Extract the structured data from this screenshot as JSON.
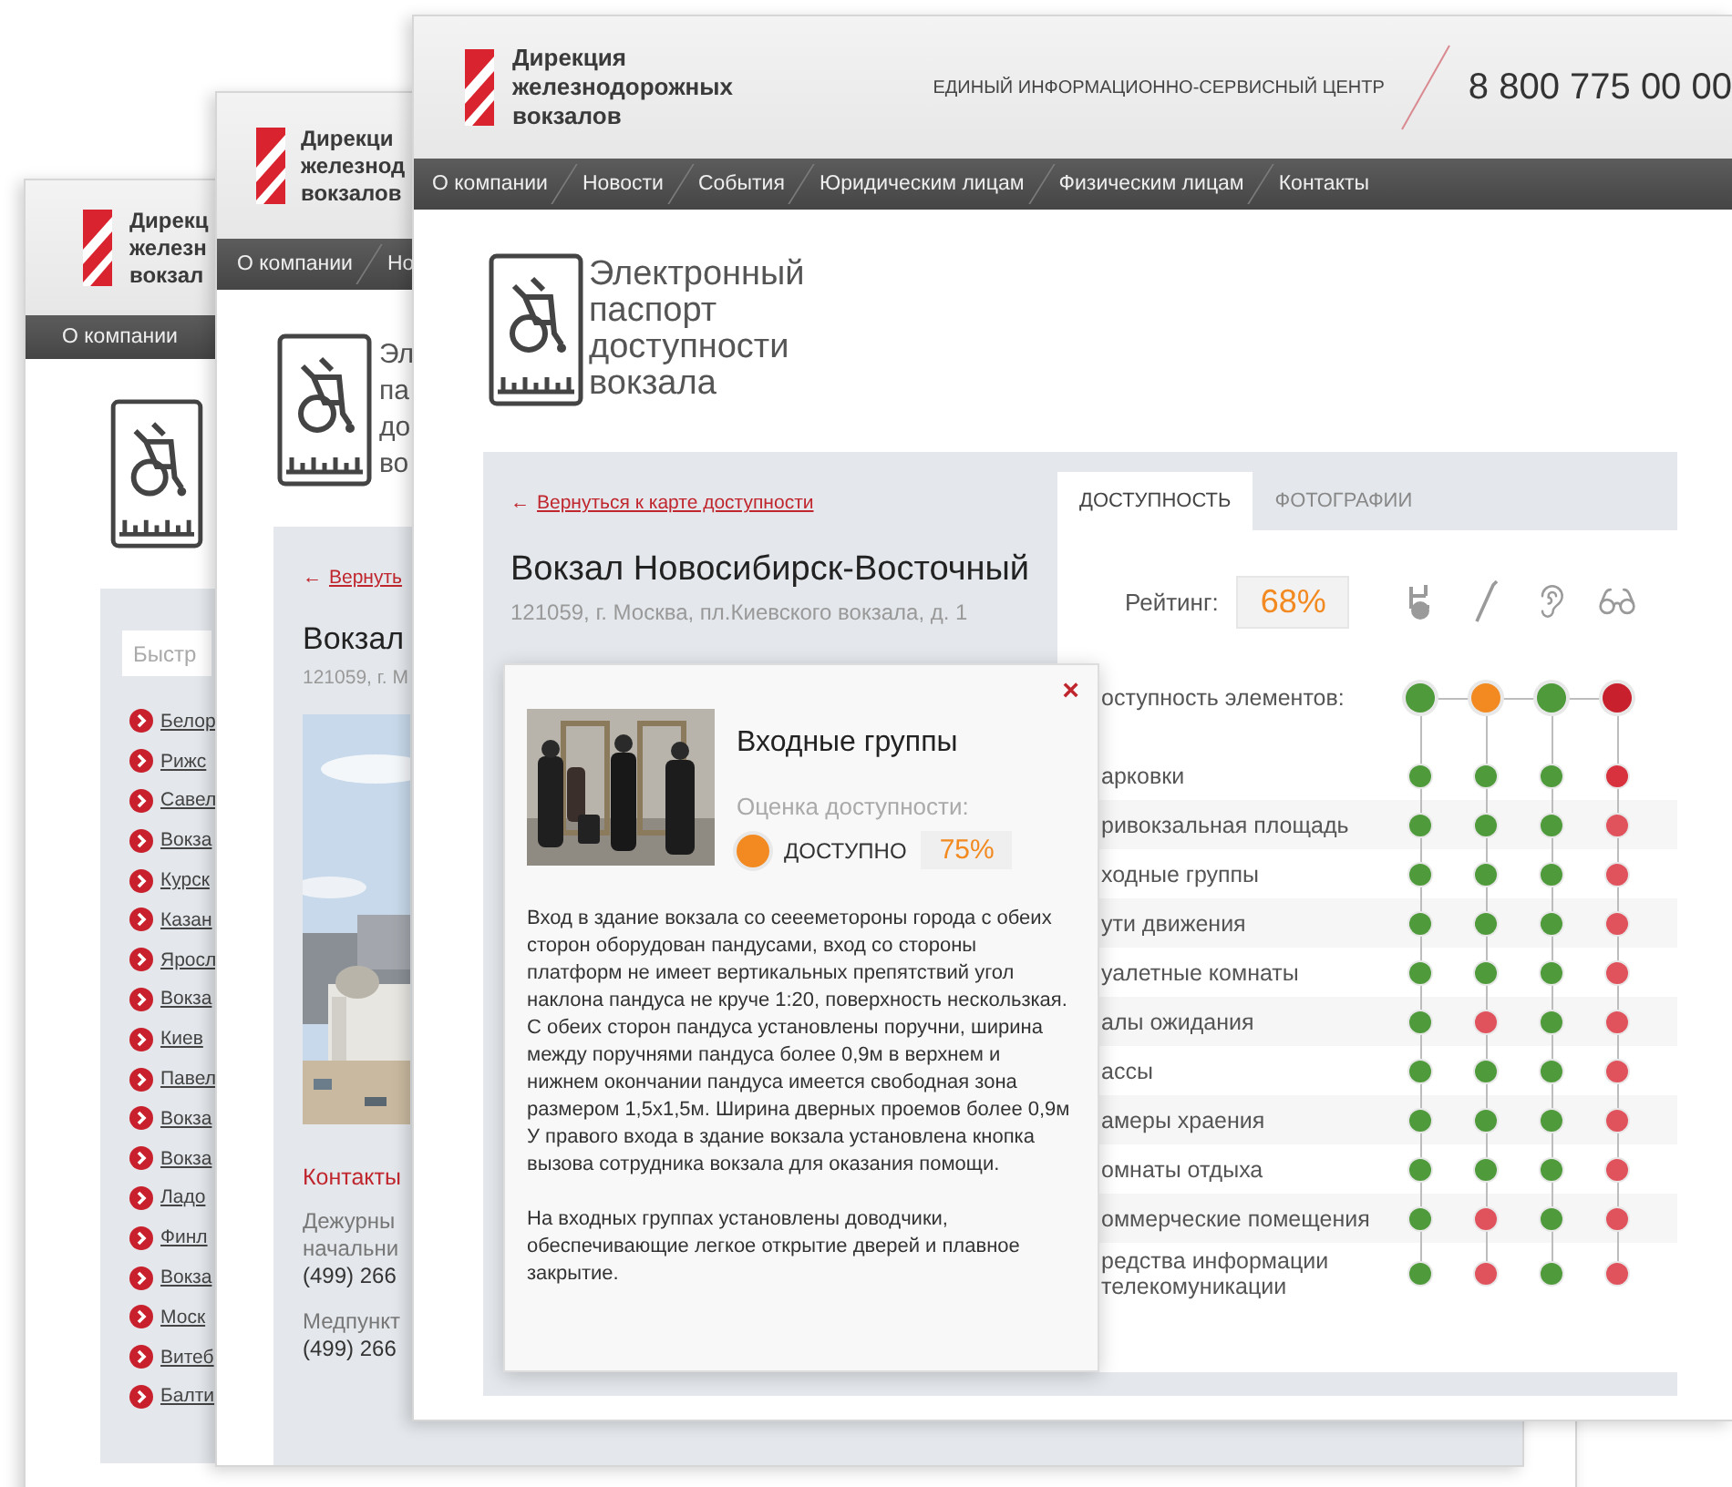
{
  "page_1": {
    "logo_lines": [
      "Дирекц",
      "железн",
      "вокзал"
    ],
    "nav_items": [
      "О компании"
    ],
    "search": {
      "placeholder": "Быстр"
    },
    "station_links": [
      "Белор",
      "Рижс",
      "Савел",
      "Вокза",
      "Курск",
      "Казан",
      "Яросл",
      "Вокза",
      "Киев",
      "Павел",
      "Вокза",
      "Вокза",
      "Ладо",
      "Финл",
      "Вокза",
      "Моск",
      "Витеб",
      "Балти"
    ]
  },
  "page_2": {
    "logo_lines": [
      "Дирекци",
      "железнод",
      "вокзалов"
    ],
    "nav_items": [
      "О компании",
      "Но"
    ],
    "passport_lines": [
      "Эл",
      "па",
      "до",
      "во"
    ],
    "back_link": {
      "arrow": "←",
      "label": "Вернуть"
    },
    "station_title": "Вокзал",
    "address": "121059, г. М",
    "contacts_title": "Контакты",
    "contacts": [
      {
        "label_lines": [
          "Дежурны",
          "начальни"
        ],
        "phone": "(499) 266"
      },
      {
        "label_lines": [
          "Медпункт"
        ],
        "phone": "(499) 266"
      }
    ]
  },
  "page_3": {
    "logo_lines": [
      "Дирекция",
      "железнодорожных",
      "вокзалов"
    ],
    "service_center": "ЕДИНЫЙ ИНФОРМАЦИОННО-СЕРВИСНЫЙ ЦЕНТР",
    "phone": "8 800 775 00 00",
    "nav_items": [
      "О компании",
      "Новости",
      "События",
      "Юридическим лицам",
      "Физическим лицам",
      "Контакты"
    ],
    "passport_lines": [
      "Электронный",
      "паспорт",
      "доступности",
      "вокзала"
    ],
    "back_link": {
      "arrow": "←",
      "label": "Вернуться к карте доступности"
    },
    "station_title": "Вокзал Новосибирск-Восточный",
    "address": "121059, г. Москва, пл.Киевского вокзала, д. 1",
    "tabs": [
      {
        "label": "ДОСТУПНОСТЬ",
        "selected": true
      },
      {
        "label": "ФОТОГРАФИИ",
        "selected": false
      }
    ],
    "rating": {
      "label": "Рейтинг:",
      "value": "68%"
    },
    "matrix": {
      "summary": {
        "label": "оступность элементов:",
        "dots": [
          {
            "color": "#4f9a3b"
          },
          {
            "color": "#f28a21"
          },
          {
            "color": "#4f9a3b"
          },
          {
            "color": "#c8202c"
          }
        ]
      },
      "rows": [
        {
          "label": "арковки",
          "dots": [
            {
              "color": "#4f9a3b"
            },
            {
              "color": "#4f9a3b"
            },
            {
              "color": "#4f9a3b"
            },
            {
              "color": "#d8323e"
            }
          ]
        },
        {
          "label": "ривокзальная площадь",
          "dots": [
            {
              "color": "#4f9a3b"
            },
            {
              "color": "#4f9a3b"
            },
            {
              "color": "#4f9a3b"
            },
            {
              "color": "#e0525c"
            }
          ]
        },
        {
          "label": "ходные группы",
          "dots": [
            {
              "color": "#4f9a3b"
            },
            {
              "color": "#4f9a3b"
            },
            {
              "color": "#4f9a3b"
            },
            {
              "color": "#e0525c"
            }
          ]
        },
        {
          "label": "ути движения",
          "dots": [
            {
              "color": "#4f9a3b"
            },
            {
              "color": "#4f9a3b"
            },
            {
              "color": "#4f9a3b"
            },
            {
              "color": "#e0525c"
            }
          ]
        },
        {
          "label": "уалетные комнаты",
          "dots": [
            {
              "color": "#4f9a3b"
            },
            {
              "color": "#4f9a3b"
            },
            {
              "color": "#4f9a3b"
            },
            {
              "color": "#e0525c"
            }
          ]
        },
        {
          "label": "алы ожидания",
          "dots": [
            {
              "color": "#4f9a3b"
            },
            {
              "color": "#e0525c"
            },
            {
              "color": "#4f9a3b"
            },
            {
              "color": "#e0525c"
            }
          ]
        },
        {
          "label": "ассы",
          "dots": [
            {
              "color": "#4f9a3b"
            },
            {
              "color": "#4f9a3b"
            },
            {
              "color": "#4f9a3b"
            },
            {
              "color": "#e0525c"
            }
          ]
        },
        {
          "label": "амеры храения",
          "dots": [
            {
              "color": "#4f9a3b"
            },
            {
              "color": "#4f9a3b"
            },
            {
              "color": "#4f9a3b"
            },
            {
              "color": "#e0525c"
            }
          ]
        },
        {
          "label": "омнаты отдыха",
          "dots": [
            {
              "color": "#4f9a3b"
            },
            {
              "color": "#4f9a3b"
            },
            {
              "color": "#4f9a3b"
            },
            {
              "color": "#e0525c"
            }
          ]
        },
        {
          "label": "оммерческие помещения",
          "dots": [
            {
              "color": "#4f9a3b"
            },
            {
              "color": "#e0525c"
            },
            {
              "color": "#4f9a3b"
            },
            {
              "color": "#e0525c"
            }
          ]
        },
        {
          "label": "редства информации\nтелекомуникации",
          "dots": [
            {
              "color": "#4f9a3b"
            },
            {
              "color": "#e0525c"
            },
            {
              "color": "#4f9a3b"
            },
            {
              "color": "#e0525c"
            }
          ]
        }
      ]
    },
    "popup": {
      "close": "×",
      "title": "Входные группы",
      "rating_label": "Оценка доступности:",
      "status": {
        "color": "#f28a21",
        "label": "ДОСТУПНО",
        "value": "75%"
      },
      "paragraphs": [
        "Вход в здание вокзала со сееемeтороны города с обеих сторон оборудован пандусами, вход со стороны платформ не имеет вертикальных препятствий угол наклона пандуса не круче 1:20, поверхность нескользкая. С обеих сторон пандуса установлены поручни, ширина между поручнями пандуса более 0,9м в верхнем и нижнем окончании пандуса имеется свободная зона размером 1,5х1,5м. Ширина дверных проемов более 0,9м У правого входа в здание вокзала установлена кнопка вызова сотрудника вокзала для оказания помощи.",
        "На входных группах установлены доводчики, обеспечивающие легкое открытие дверей и плавное закрытие."
      ]
    }
  }
}
